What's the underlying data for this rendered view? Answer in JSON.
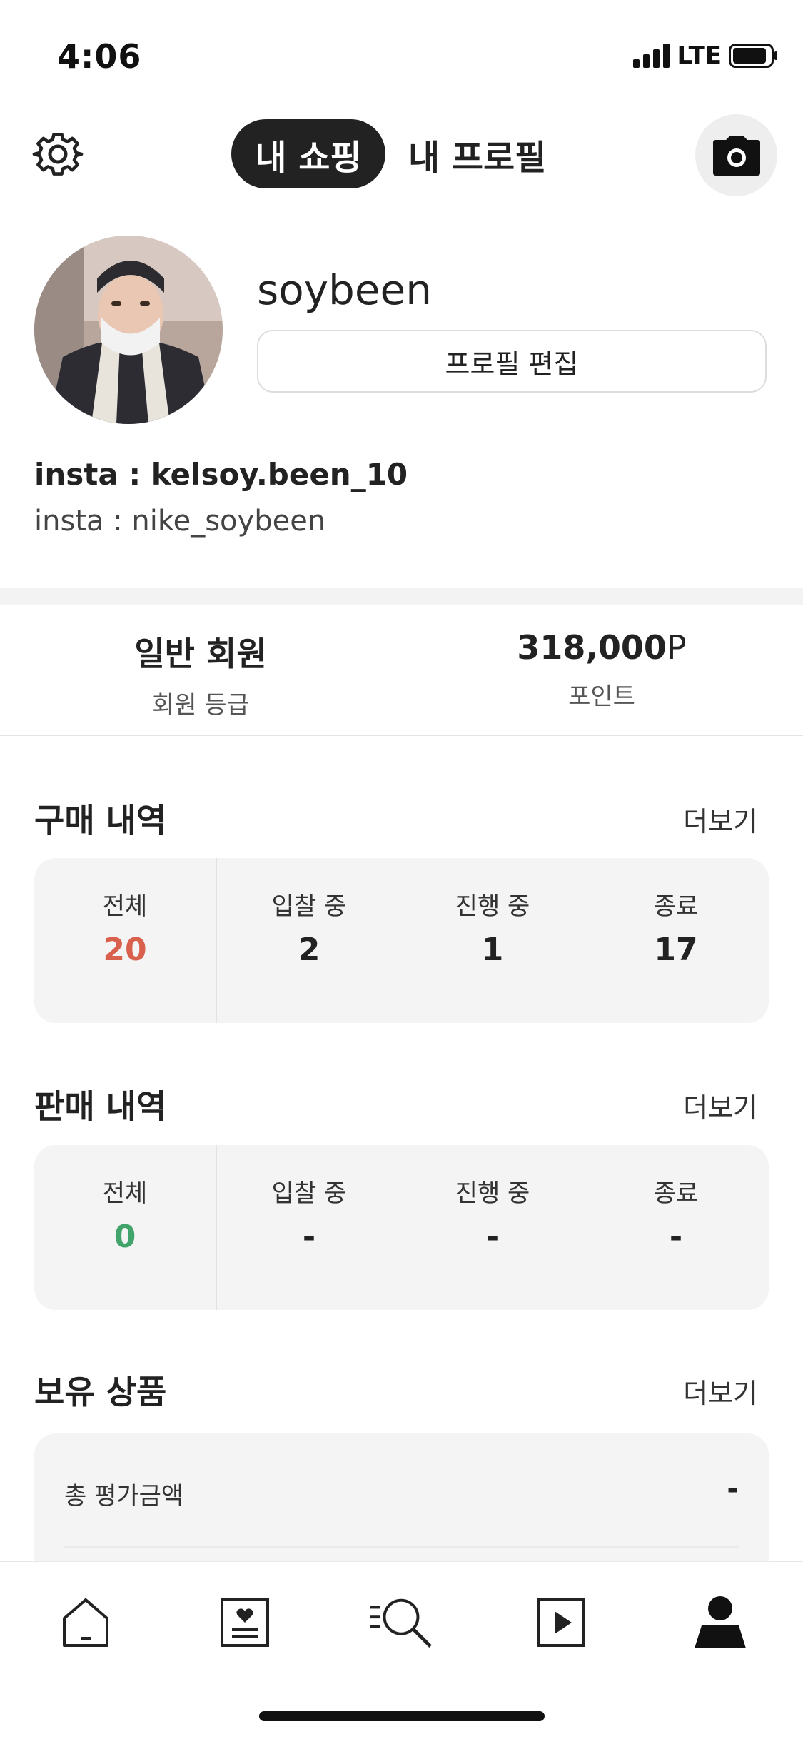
{
  "status_bar": {
    "time": "4:06",
    "network": "LTE"
  },
  "header": {
    "tab_active": "내 쇼핑",
    "tab_inactive": "내 프로필"
  },
  "profile": {
    "username": "soybeen",
    "edit_button": "프로필 편집",
    "bio_line1": "insta : kelsoy.been_10",
    "bio_line2": "insta : nike_soybeen"
  },
  "membership": {
    "grade_value": "일반 회원",
    "grade_label": "회원 등급",
    "points_value": "318,000",
    "points_unit": "P",
    "points_label": "포인트"
  },
  "purchase": {
    "title": "구매 내역",
    "more": "더보기",
    "cells": [
      {
        "label": "전체",
        "value": "20"
      },
      {
        "label": "입찰 중",
        "value": "2"
      },
      {
        "label": "진행 중",
        "value": "1"
      },
      {
        "label": "종료",
        "value": "17"
      }
    ]
  },
  "sales": {
    "title": "판매 내역",
    "more": "더보기",
    "cells": [
      {
        "label": "전체",
        "value": "0"
      },
      {
        "label": "입찰 중",
        "value": "-"
      },
      {
        "label": "진행 중",
        "value": "-"
      },
      {
        "label": "종료",
        "value": "-"
      }
    ]
  },
  "holdings": {
    "title": "보유 상품",
    "more": "더보기",
    "total_label": "총 평가금액",
    "total_value": "-"
  },
  "colors": {
    "purchase_total": "#d9604c",
    "sales_total": "#41a46b",
    "dark": "#222222",
    "card_bg": "#f4f4f4"
  },
  "icons": {
    "settings": "gear-icon",
    "camera": "camera-icon",
    "nav": [
      "home-icon",
      "heart-card-icon",
      "search-list-icon",
      "play-icon",
      "person-icon"
    ]
  }
}
